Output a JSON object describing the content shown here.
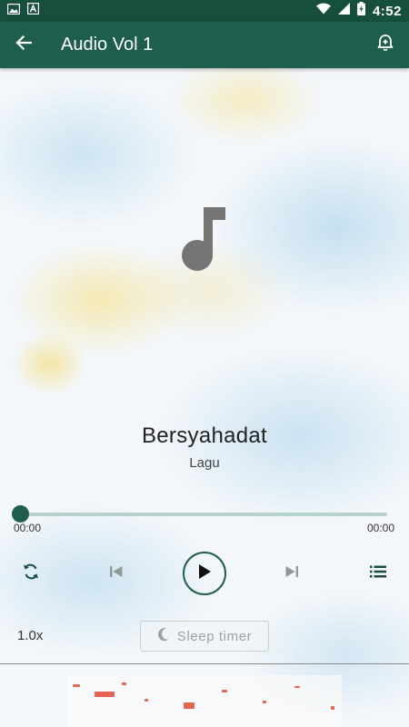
{
  "status_bar": {
    "time": "4:52",
    "left_icons": [
      "image-icon",
      "text-a-icon"
    ],
    "right_icons": [
      "wifi-icon",
      "signal-icon",
      "battery-icon"
    ]
  },
  "app_bar": {
    "title": "Audio Vol 1",
    "back_icon": "arrow-back-icon",
    "action_icon": "alarm-add-icon",
    "color": "#1e5e4c"
  },
  "player": {
    "artwork_icon": "music-note-icon",
    "track_title": "Bersyahadat",
    "track_subtitle": "Lagu",
    "progress_fraction": 0,
    "elapsed": "00:00",
    "duration": "00:00",
    "controls": [
      "repeat-icon",
      "skip-previous-icon",
      "play-icon",
      "skip-next-icon",
      "playlist-icon"
    ],
    "speed": "1.0x",
    "sleep_timer_label": "Sleep timer",
    "sleep_timer_icon": "moon-icon"
  },
  "colors": {
    "accent": "#1e5e4c",
    "status_bar": "#174f3f",
    "seek_track": "#b7d2cc"
  }
}
